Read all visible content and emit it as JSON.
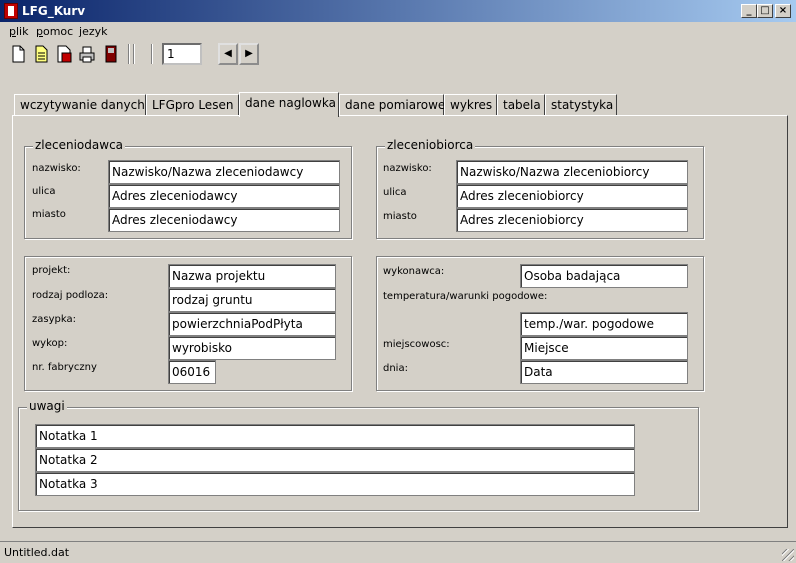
{
  "window": {
    "title": "LFG_Kurv",
    "minimize": "_",
    "maximize": "□",
    "close": "×"
  },
  "menu": [
    "plik",
    "pomoc",
    "jezyk"
  ],
  "toolbar": {
    "page_value": "1",
    "prev": "◀",
    "next": "▶",
    "icons": [
      "new-file-icon",
      "open-file-icon",
      "save-file-icon",
      "print-icon",
      "exit-icon"
    ]
  },
  "tabs": [
    "wczytywanie danych",
    "LFGpro Lesen",
    "dane naglowka",
    "dane pomiarowe",
    "wykres",
    "tabela",
    "statystyka"
  ],
  "active_tab": "dane naglowka",
  "zleceniodawca": {
    "title": "zleceniodawca",
    "labels": [
      "nazwisko:",
      "ulica",
      "miasto"
    ],
    "values": [
      "Nazwisko/Nazwa zleceniodawcy",
      "Adres zleceniodawcy",
      "Adres zleceniodawcy"
    ]
  },
  "zleceniobiorca": {
    "title": "zleceniobiorca",
    "labels": [
      "nazwisko:",
      "ulica",
      "miasto"
    ],
    "values": [
      "Nazwisko/Nazwa zleceniobiorcy",
      "Adres zleceniobiorcy",
      "Adres zleceniobiorcy"
    ]
  },
  "projekt": {
    "labels": [
      "projekt:",
      "rodzaj podloza:",
      "zasypka:",
      "wykop:",
      "nr. fabryczny"
    ],
    "values": [
      "Nazwa projektu",
      "rodzaj gruntu",
      "powierzchniaPodPłyta",
      "wyrobisko",
      "06016"
    ]
  },
  "wykonawca": {
    "labels": [
      "wykonawca:",
      "temperatura/warunki pogodowe:",
      "miejscowosc:",
      "dnia:"
    ],
    "values": [
      "Osoba badająca",
      "temp./war. pogodowe",
      "Miejsce",
      "Data"
    ]
  },
  "uwagi": {
    "title": "uwagi",
    "values": [
      "Notatka 1",
      "Notatka 2",
      "Notatka 3"
    ]
  },
  "status": "Untitled.dat"
}
